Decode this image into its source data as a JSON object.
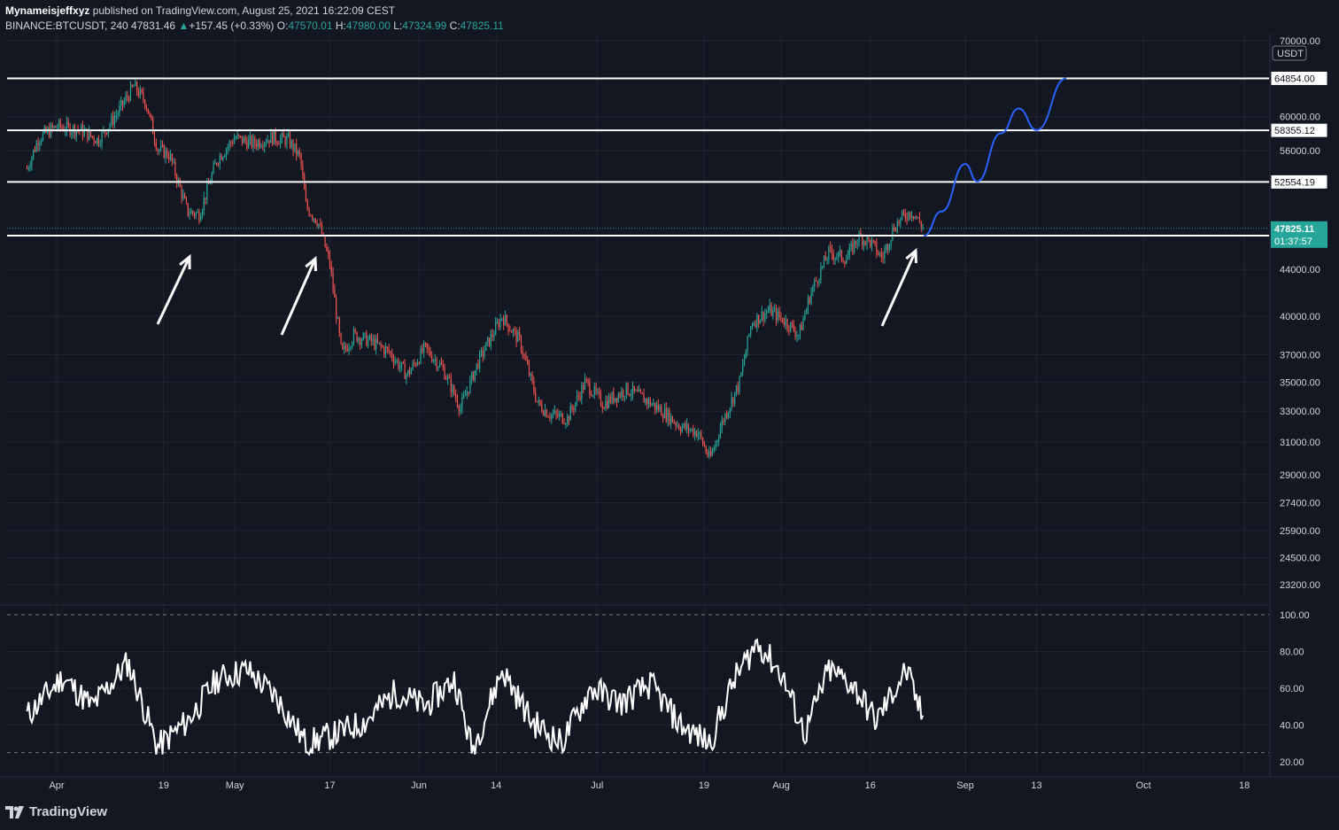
{
  "header": {
    "author": "Mynameisjeffxyz",
    "published": " published on TradingView.com, August 25, 2021 16:22:09 CEST",
    "symbol": "BINANCE:BTCUSDT, 240",
    "last": "47831.46",
    "change": "+157.45 (+0.33%)",
    "o_label": "O:",
    "o_value": "47570.01",
    "h_label": "H:",
    "h_value": "47980.00",
    "l_label": "L:",
    "l_value": "47324.99",
    "c_label": "C:",
    "c_value": "47825.11"
  },
  "footer": {
    "brand": "TradingView",
    "icon": "tradingview-logo-icon"
  },
  "colors": {
    "background": "#131722",
    "grid": "#1f2430",
    "up": "#26a69a",
    "down": "#ef5350",
    "hline": "#ffffff",
    "projection": "#2962ff",
    "rsi": "#ffffff",
    "current_price_bg": "#26a69a"
  },
  "chart_data": [
    {
      "type": "candlestick",
      "title": "",
      "scale": "log",
      "ylim": [
        22500,
        70000
      ],
      "y_unit": "USDT",
      "x_ticks": [
        "Apr",
        "19",
        "May",
        "17",
        "Jun",
        "14",
        "Jul",
        "19",
        "Aug",
        "16",
        "Sep",
        "13",
        "Oct",
        "18"
      ],
      "y_ticks": [
        "70000.00",
        "60000.00",
        "56000.00",
        "44000.00",
        "40000.00",
        "37000.00",
        "35000.00",
        "33000.00",
        "31000.00",
        "29000.00",
        "27400.00",
        "25900.00",
        "24500.00",
        "23200.00"
      ],
      "grid": true,
      "horizontal_levels": [
        "64854.00",
        "58355.12",
        "52554.19",
        "47122.28"
      ],
      "current_price": "47825.11",
      "countdown": "01:37:57",
      "price_path": [
        {
          "date": "2021-03-27",
          "close": 54000
        },
        {
          "date": "2021-03-29",
          "close": 57500
        },
        {
          "date": "2021-04-01",
          "close": 58800
        },
        {
          "date": "2021-04-05",
          "close": 58400
        },
        {
          "date": "2021-04-08",
          "close": 57200
        },
        {
          "date": "2021-04-11",
          "close": 60200
        },
        {
          "date": "2021-04-14",
          "close": 63800
        },
        {
          "date": "2021-04-16",
          "close": 61800
        },
        {
          "date": "2021-04-18",
          "close": 56200
        },
        {
          "date": "2021-04-20",
          "close": 55500
        },
        {
          "date": "2021-04-23",
          "close": 49500
        },
        {
          "date": "2021-04-25",
          "close": 49200
        },
        {
          "date": "2021-04-28",
          "close": 55000
        },
        {
          "date": "2021-05-01",
          "close": 57500
        },
        {
          "date": "2021-05-04",
          "close": 56800
        },
        {
          "date": "2021-05-07",
          "close": 57500
        },
        {
          "date": "2021-05-10",
          "close": 57200
        },
        {
          "date": "2021-05-12",
          "close": 55200
        },
        {
          "date": "2021-05-13",
          "close": 50000
        },
        {
          "date": "2021-05-15",
          "close": 48500
        },
        {
          "date": "2021-05-17",
          "close": 44500
        },
        {
          "date": "2021-05-19",
          "close": 37000
        },
        {
          "date": "2021-05-21",
          "close": 38500
        },
        {
          "date": "2021-05-24",
          "close": 38000
        },
        {
          "date": "2021-05-27",
          "close": 37200
        },
        {
          "date": "2021-05-30",
          "close": 35500
        },
        {
          "date": "2021-06-02",
          "close": 37500
        },
        {
          "date": "2021-06-05",
          "close": 36000
        },
        {
          "date": "2021-06-08",
          "close": 33200
        },
        {
          "date": "2021-06-11",
          "close": 36500
        },
        {
          "date": "2021-06-15",
          "close": 40000
        },
        {
          "date": "2021-06-18",
          "close": 38000
        },
        {
          "date": "2021-06-21",
          "close": 33500
        },
        {
          "date": "2021-06-23",
          "close": 32800
        },
        {
          "date": "2021-06-26",
          "close": 32500
        },
        {
          "date": "2021-06-29",
          "close": 35000
        },
        {
          "date": "2021-07-02",
          "close": 33500
        },
        {
          "date": "2021-07-06",
          "close": 34500
        },
        {
          "date": "2021-07-09",
          "close": 33800
        },
        {
          "date": "2021-07-12",
          "close": 33000
        },
        {
          "date": "2021-07-15",
          "close": 32000
        },
        {
          "date": "2021-07-18",
          "close": 31600
        },
        {
          "date": "2021-07-20",
          "close": 29900
        },
        {
          "date": "2021-07-22",
          "close": 32200
        },
        {
          "date": "2021-07-25",
          "close": 35000
        },
        {
          "date": "2021-07-27",
          "close": 39500
        },
        {
          "date": "2021-07-30",
          "close": 40500
        },
        {
          "date": "2021-08-02",
          "close": 39500
        },
        {
          "date": "2021-08-04",
          "close": 38500
        },
        {
          "date": "2021-08-06",
          "close": 42000
        },
        {
          "date": "2021-08-09",
          "close": 45500
        },
        {
          "date": "2021-08-12",
          "close": 45000
        },
        {
          "date": "2021-08-14",
          "close": 47000
        },
        {
          "date": "2021-08-16",
          "close": 46500
        },
        {
          "date": "2021-08-18",
          "close": 45000
        },
        {
          "date": "2021-08-20",
          "close": 48000
        },
        {
          "date": "2021-08-22",
          "close": 49200
        },
        {
          "date": "2021-08-23",
          "close": 49500
        },
        {
          "date": "2021-08-25",
          "close": 47825
        }
      ],
      "projection_path": [
        {
          "date": "2021-08-25",
          "price": 47100
        },
        {
          "date": "2021-08-28",
          "price": 49500
        },
        {
          "date": "2021-09-01",
          "price": 54500
        },
        {
          "date": "2021-09-03",
          "price": 52600
        },
        {
          "date": "2021-09-07",
          "price": 58000
        },
        {
          "date": "2021-09-10",
          "price": 61000
        },
        {
          "date": "2021-09-13",
          "price": 58400
        },
        {
          "date": "2021-09-18",
          "price": 64854
        }
      ],
      "arrows": 3
    },
    {
      "type": "line",
      "title": "",
      "indicator": "RSI",
      "ylim": [
        20,
        100
      ],
      "y_ticks": [
        "100.00",
        "80.00",
        "60.00",
        "40.00",
        "20.00"
      ],
      "bands": [
        100,
        25
      ],
      "series_path": [
        {
          "date": "2021-03-27",
          "value": 45
        },
        {
          "date": "2021-04-02",
          "value": 66
        },
        {
          "date": "2021-04-07",
          "value": 50
        },
        {
          "date": "2021-04-13",
          "value": 74
        },
        {
          "date": "2021-04-18",
          "value": 28
        },
        {
          "date": "2021-04-23",
          "value": 42
        },
        {
          "date": "2021-04-28",
          "value": 65
        },
        {
          "date": "2021-05-03",
          "value": 70
        },
        {
          "date": "2021-05-08",
          "value": 55
        },
        {
          "date": "2021-05-13",
          "value": 30
        },
        {
          "date": "2021-05-18",
          "value": 35
        },
        {
          "date": "2021-05-23",
          "value": 42
        },
        {
          "date": "2021-05-28",
          "value": 58
        },
        {
          "date": "2021-06-02",
          "value": 50
        },
        {
          "date": "2021-06-07",
          "value": 65
        },
        {
          "date": "2021-06-10",
          "value": 26
        },
        {
          "date": "2021-06-15",
          "value": 70
        },
        {
          "date": "2021-06-20",
          "value": 42
        },
        {
          "date": "2021-06-25",
          "value": 30
        },
        {
          "date": "2021-06-30",
          "value": 60
        },
        {
          "date": "2021-07-05",
          "value": 52
        },
        {
          "date": "2021-07-10",
          "value": 62
        },
        {
          "date": "2021-07-15",
          "value": 40
        },
        {
          "date": "2021-07-20",
          "value": 30
        },
        {
          "date": "2021-07-24",
          "value": 64
        },
        {
          "date": "2021-07-28",
          "value": 85
        },
        {
          "date": "2021-08-01",
          "value": 68
        },
        {
          "date": "2021-08-05",
          "value": 35
        },
        {
          "date": "2021-08-09",
          "value": 70
        },
        {
          "date": "2021-08-13",
          "value": 62
        },
        {
          "date": "2021-08-17",
          "value": 42
        },
        {
          "date": "2021-08-22",
          "value": 70
        },
        {
          "date": "2021-08-25",
          "value": 42
        }
      ]
    }
  ]
}
